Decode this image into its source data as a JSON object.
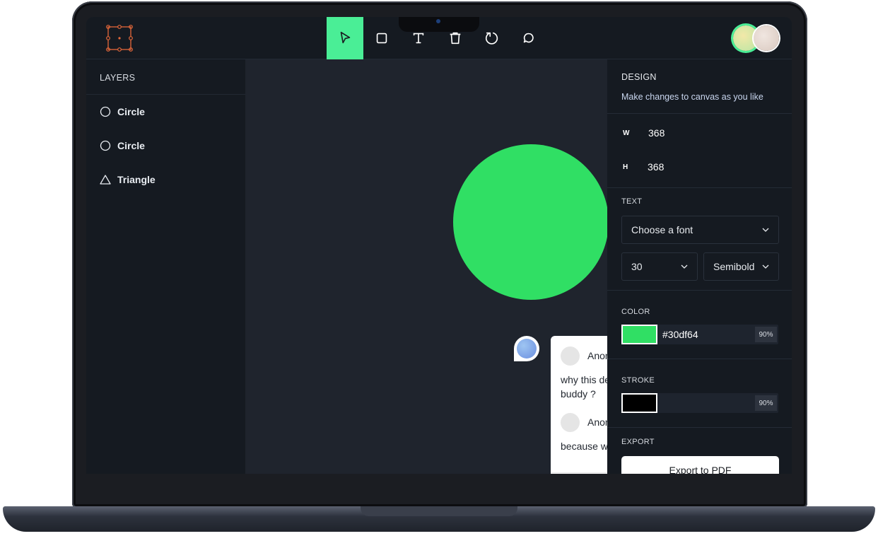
{
  "toolbar": {
    "tools": [
      {
        "name": "select",
        "icon": "cursor-icon",
        "active": true
      },
      {
        "name": "rectangle",
        "icon": "square-icon"
      },
      {
        "name": "text",
        "icon": "text-icon"
      },
      {
        "name": "delete",
        "icon": "trash-icon"
      },
      {
        "name": "reset",
        "icon": "reset-icon"
      },
      {
        "name": "comments",
        "icon": "comment-icon"
      }
    ],
    "active_color": "#4aee96"
  },
  "layers": {
    "title": "LAYERS",
    "items": [
      {
        "label": "Circle",
        "icon": "circle-icon"
      },
      {
        "label": "Circle",
        "icon": "circle-icon"
      },
      {
        "label": "Triangle",
        "icon": "triangle-icon"
      }
    ]
  },
  "canvas": {
    "shape_color": "#30df64",
    "comment": {
      "author_1": "Anon",
      "message_1": "why this de buddy ?",
      "author_2": "Anon",
      "message_2": "because w"
    }
  },
  "design": {
    "title": "DESIGN",
    "subtitle": "Make changes to canvas as you like",
    "width_label": "W",
    "width_value": "368",
    "height_label": "H",
    "height_value": "368",
    "text_label": "TEXT",
    "font_placeholder": "Choose a font",
    "font_size": "30",
    "font_weight": "Semibold",
    "color_label": "COLOR",
    "fill_hex": "#30df64",
    "fill_opacity": "90%",
    "stroke_label": "STROKE",
    "stroke_color": "#000000",
    "stroke_opacity": "90%",
    "export_label": "EXPORT",
    "export_button": "Export to PDF"
  }
}
